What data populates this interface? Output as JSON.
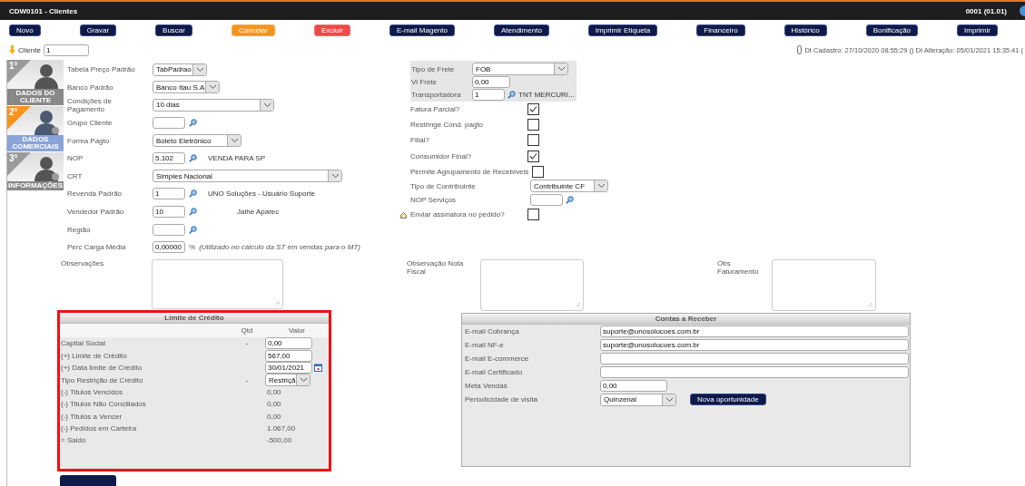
{
  "window": {
    "title": "CDW0101 - Clientes",
    "company": "0001 (01.01)"
  },
  "toolbar": [
    {
      "label": "Novo",
      "kind": "primary"
    },
    {
      "label": "Gravar",
      "kind": "primary"
    },
    {
      "label": "Buscar",
      "kind": "primary"
    },
    {
      "label": "Cancelar",
      "kind": "warning"
    },
    {
      "label": "Excluir",
      "kind": "danger"
    },
    {
      "label": "E-mail Magento",
      "kind": "primary"
    },
    {
      "label": "Atendimento",
      "kind": "primary"
    },
    {
      "label": "Imprimir Etiqueta",
      "kind": "primary"
    },
    {
      "label": "Financeiro",
      "kind": "primary"
    },
    {
      "label": "Histórico",
      "kind": "primary"
    },
    {
      "label": "Bonificação",
      "kind": "primary"
    },
    {
      "label": "Imprimir",
      "kind": "primary"
    }
  ],
  "client": {
    "label": "Cliente",
    "value": "1"
  },
  "audit": "Dt Cadastro: 27/10/2020 08:55:29 () Dt Alteração: 05/01/2021 15:35:41 (",
  "steps": [
    {
      "number": "1°",
      "caption": "DADOS DO CLIENTE",
      "selected": false
    },
    {
      "number": "2°",
      "caption": "DADOS COMERCIAIS",
      "selected": true
    },
    {
      "number": "3°",
      "caption": "INFORMAÇÕES",
      "selected": false
    }
  ],
  "left_fields": [
    {
      "kind": "select",
      "label": "Tabela Preço Padrão",
      "value": "TabPadrao"
    },
    {
      "kind": "select",
      "label": "Banco Padrão",
      "value": "Banco Itau S.A."
    },
    {
      "kind": "select",
      "label": "Condições de Pagamento",
      "value": "10 dias"
    },
    {
      "kind": "lookup",
      "label": "Grupo Cliente"
    },
    {
      "kind": "select",
      "label": "Forma Pagto",
      "value": "Boleto Eletrônico"
    },
    {
      "kind": "lookup",
      "label": "NOP",
      "value": "5.102",
      "text": "VENDA PARA SP"
    },
    {
      "kind": "select",
      "label": "CRT",
      "value": "Simples Nacional"
    },
    {
      "kind": "lookup",
      "label": "Revenda Padrão",
      "value": "1",
      "text": "UNO Soluções - Usuário Suporte"
    },
    {
      "kind": "lookup",
      "label": "Vendedor Padrão",
      "value": "10",
      "text": "Jaihe Aparec"
    },
    {
      "kind": "lookup",
      "label": "Região"
    },
    {
      "kind": "percent",
      "label": "Perc Carga Média",
      "value": "0,00000",
      "unit": "%",
      "note": "(Utilizado no cálculo da ST em vendas para o MT)"
    }
  ],
  "freight": [
    {
      "kind": "select",
      "label": "Tipo de Frete",
      "value": "FOB"
    },
    {
      "kind": "input",
      "label": "Vl Frete",
      "value": "0,00"
    },
    {
      "kind": "lookup",
      "label": "Transportadora",
      "value": "1",
      "text": "TNT MERCURI..."
    }
  ],
  "options": [
    {
      "kind": "checkbox",
      "label": "Fatura Parcial?",
      "checked": true
    },
    {
      "kind": "checkbox",
      "label": "Restringe Cond. pagto",
      "checked": false
    },
    {
      "kind": "checkbox",
      "label": "Filial?",
      "checked": false
    },
    {
      "kind": "checkbox",
      "label": "Consumidor Final?",
      "checked": true
    },
    {
      "kind": "checkbox",
      "label": "Permite Agrupamento de Recebíveis",
      "checked": false
    },
    {
      "kind": "select",
      "label": "Tipo de Contribuinte",
      "value": "Contribuinte CF"
    },
    {
      "kind": "lookup",
      "label": "NOP Serviços"
    },
    {
      "kind": "checkbox",
      "label": "Enviar assinatura no pedido?",
      "checked": false
    }
  ],
  "notes": [
    {
      "label": "Observações"
    },
    {
      "label": "Observação Nota Fiscal"
    },
    {
      "label": "Obs Faturamento"
    }
  ],
  "credit_limit": {
    "title": "Limite de Crédito",
    "highlighted": true,
    "columns": [
      "Qtd",
      "Valor"
    ],
    "rows": [
      {
        "kind": "input",
        "label": "Capital Social",
        "qtd": "-",
        "value": "0,00"
      },
      {
        "kind": "input",
        "label": "(+) Limite de Crédito",
        "value": "567,00"
      },
      {
        "kind": "date",
        "label": "(+) Data limite de Crédito",
        "value": "30/01/2021"
      },
      {
        "kind": "select",
        "label": "Tipo Restrição de Crédito",
        "qtd": "-",
        "value": "Restriçã"
      },
      {
        "kind": "text",
        "label": "(-) Titulos Vencidos",
        "value": "0,00"
      },
      {
        "kind": "text",
        "label": "(-) Titulos Não Conciliados",
        "value": "0,00"
      },
      {
        "kind": "text",
        "label": "(-) Titulos a Vencer",
        "value": "0,00"
      },
      {
        "kind": "text",
        "label": "(-) Pedidos em Carteira",
        "value": "1.067,00"
      },
      {
        "kind": "text",
        "label": "= Saldo",
        "value": "-500,00"
      }
    ]
  },
  "receivables": {
    "title": "Contas a Receber",
    "rows": [
      {
        "kind": "input",
        "label": "E-mail Cobrança",
        "value": "suporte@unosolucoes.com.br"
      },
      {
        "kind": "input",
        "label": "E-mail NF-e",
        "value": "suporte@unosolucoes.com.br"
      },
      {
        "kind": "input",
        "label": "E-mail E-commerce"
      },
      {
        "kind": "input",
        "label": "E-mail Certificado"
      },
      {
        "kind": "short",
        "label": "Meta Vendas",
        "value": "0,00"
      },
      {
        "kind": "select",
        "label": "Periodicidade de visita",
        "value": "Quinzenal",
        "button": "Nova oportunidade"
      }
    ]
  }
}
